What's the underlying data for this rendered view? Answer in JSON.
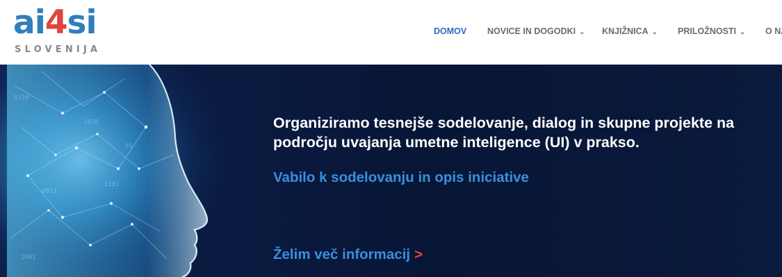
{
  "logo": {
    "part1": "ai",
    "part2": "4",
    "part3": "si",
    "subtitle": "SLOVENIJA",
    "colors": {
      "blue": "#2f7fbd",
      "red": "#e0443a",
      "gray": "#808a92"
    }
  },
  "nav": {
    "items": [
      {
        "label": "DOMOV",
        "active": true
      },
      {
        "label": "NOVICE IN DOGODKI",
        "dropdown": true
      },
      {
        "label": "KNJIŽNICA",
        "dropdown": true
      },
      {
        "label": "PRILOŽNOSTI",
        "dropdown": true
      },
      {
        "label": "O NA"
      }
    ],
    "chevron": "⌄",
    "active_color": "#2b6bbd"
  },
  "hero": {
    "headline": "Organiziramo tesnejše sodelovanje, dialog in skupne projekte na področju uvajanja umetne inteligence (UI) v prakso.",
    "invite_link": "Vabilo k sodelovanju in opis iniciative",
    "more_link": "Želim več informacij",
    "more_arrow": ">",
    "image_icon": "ai-face-illustration",
    "colors": {
      "background": "#0a1a40",
      "link": "#3a8fdb",
      "arrow": "#e8443a"
    }
  }
}
